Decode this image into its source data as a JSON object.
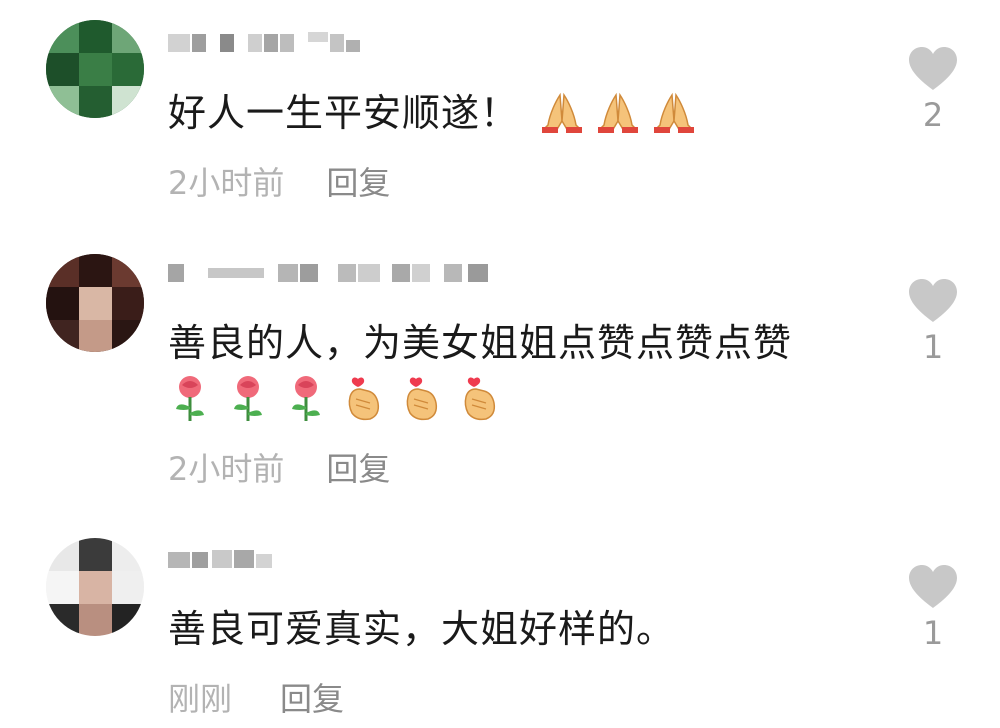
{
  "comments": [
    {
      "text": "好人一生平安顺遂！",
      "emojis": [
        "pray",
        "pray",
        "pray"
      ],
      "time": "2小时前",
      "reply_label": "回复",
      "like_count": "2"
    },
    {
      "text": "善良的人，为美女姐姐点赞点赞点赞",
      "emojis": [
        "rose",
        "rose",
        "rose",
        "heart-hands",
        "heart-hands",
        "heart-hands"
      ],
      "time": "2小时前",
      "reply_label": "回复",
      "like_count": "1"
    },
    {
      "text": "善良可爱真实，大姐好样的。",
      "emojis": [],
      "time": "刚刚",
      "reply_label": "回复",
      "like_count": "1"
    }
  ],
  "colors": {
    "heart": "#c8c8c8",
    "time": "#b3b3b3",
    "reply": "#8a8a8a"
  }
}
